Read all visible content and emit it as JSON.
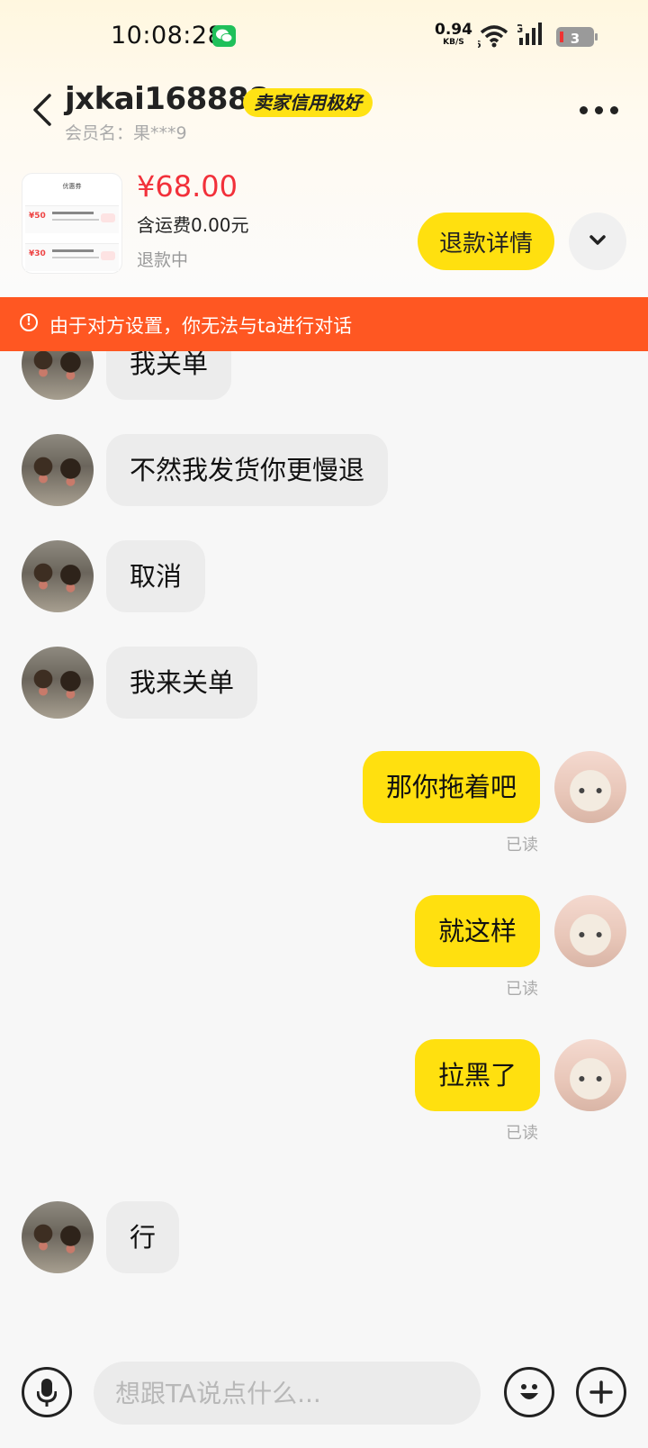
{
  "status_bar": {
    "time": "10:08:28",
    "net_speed": "0.94",
    "net_unit": "KB/S",
    "wifi_sub": "6",
    "network": "5G",
    "battery": "3",
    "notification_icon": "wechat-icon"
  },
  "header": {
    "shop_name": "jxkai168888",
    "credit_badge": "卖家信用极好",
    "member_name": "会员名：果***9"
  },
  "product": {
    "price": "¥68.00",
    "shipping": "含运费0.00元",
    "status": "退款中",
    "refund_button": "退款详情",
    "thumb": {
      "title": "优惠券",
      "coupon1": "¥50",
      "coupon2": "¥30"
    }
  },
  "warning": {
    "text": "由于对方设置，你无法与ta进行对话"
  },
  "messages": [
    {
      "side": "left",
      "text": "我关单"
    },
    {
      "side": "left",
      "text": "不然我发货你更慢退"
    },
    {
      "side": "left",
      "text": "取消"
    },
    {
      "side": "left",
      "text": "我来关单"
    },
    {
      "side": "right",
      "text": "那你拖着吧",
      "status": "已读"
    },
    {
      "side": "right",
      "text": "就这样",
      "status": "已读"
    },
    {
      "side": "right",
      "text": "拉黑了",
      "status": "已读"
    },
    {
      "side": "left",
      "text": "行"
    }
  ],
  "input_bar": {
    "placeholder": "想跟TA说点什么..."
  },
  "colors": {
    "accent_yellow": "#ffe00f",
    "warning_orange": "#ff5722",
    "price_red": "#f2303a"
  }
}
